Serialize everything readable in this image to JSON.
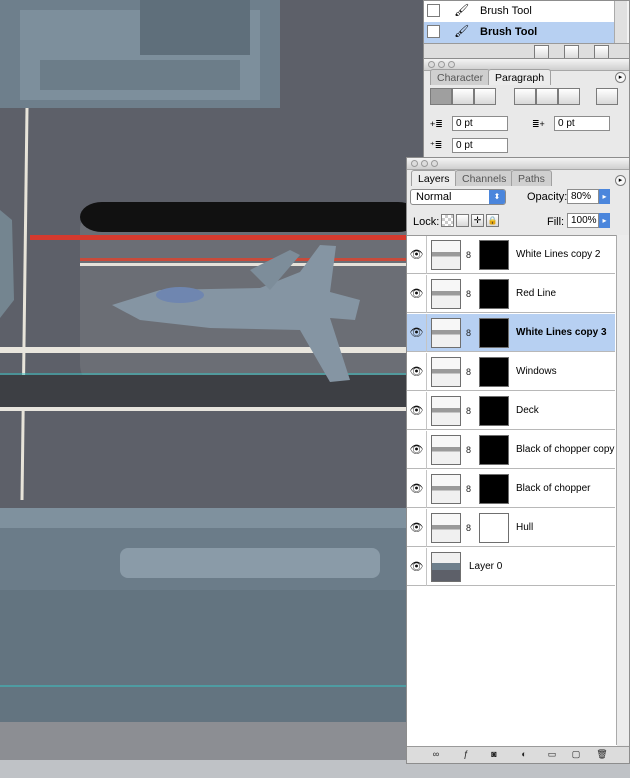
{
  "brushes_panel": {
    "items": [
      {
        "label": "Brush Tool",
        "selected": false
      },
      {
        "label": "Brush Tool",
        "selected": true
      }
    ]
  },
  "character_panel": {
    "tabs": [
      {
        "label": "Character",
        "active": false
      },
      {
        "label": "Paragraph",
        "active": true
      }
    ],
    "indent_left": "0 pt",
    "indent_right": "0 pt",
    "space_before": "0 pt"
  },
  "layers_panel": {
    "tabs": [
      {
        "label": "Layers",
        "active": true
      },
      {
        "label": "Channels",
        "active": false
      },
      {
        "label": "Paths",
        "active": false
      }
    ],
    "blend_mode": "Normal",
    "opacity_label": "Opacity:",
    "opacity_value": "80%",
    "lock_label": "Lock:",
    "fill_label": "Fill:",
    "fill_value": "100%",
    "layers": [
      {
        "name": "White Lines copy 2",
        "selected": false
      },
      {
        "name": "Red Line",
        "selected": false
      },
      {
        "name": "White Lines copy 3",
        "selected": true
      },
      {
        "name": "Windows",
        "selected": false
      },
      {
        "name": "Deck",
        "selected": false
      },
      {
        "name": "Black of chopper copy",
        "selected": false
      },
      {
        "name": "Black of chopper",
        "selected": false
      },
      {
        "name": "Hull",
        "selected": false
      },
      {
        "name": "Layer 0",
        "selected": false
      }
    ]
  },
  "icons": {
    "eye": "eye-icon",
    "brush": "brush-icon",
    "link": "chain-link-icon",
    "menu": "panel-menu-icon"
  },
  "colors": {
    "selection": "#b7d0f2",
    "deck": "#5a5d66",
    "red_line": "#d53a2e"
  }
}
